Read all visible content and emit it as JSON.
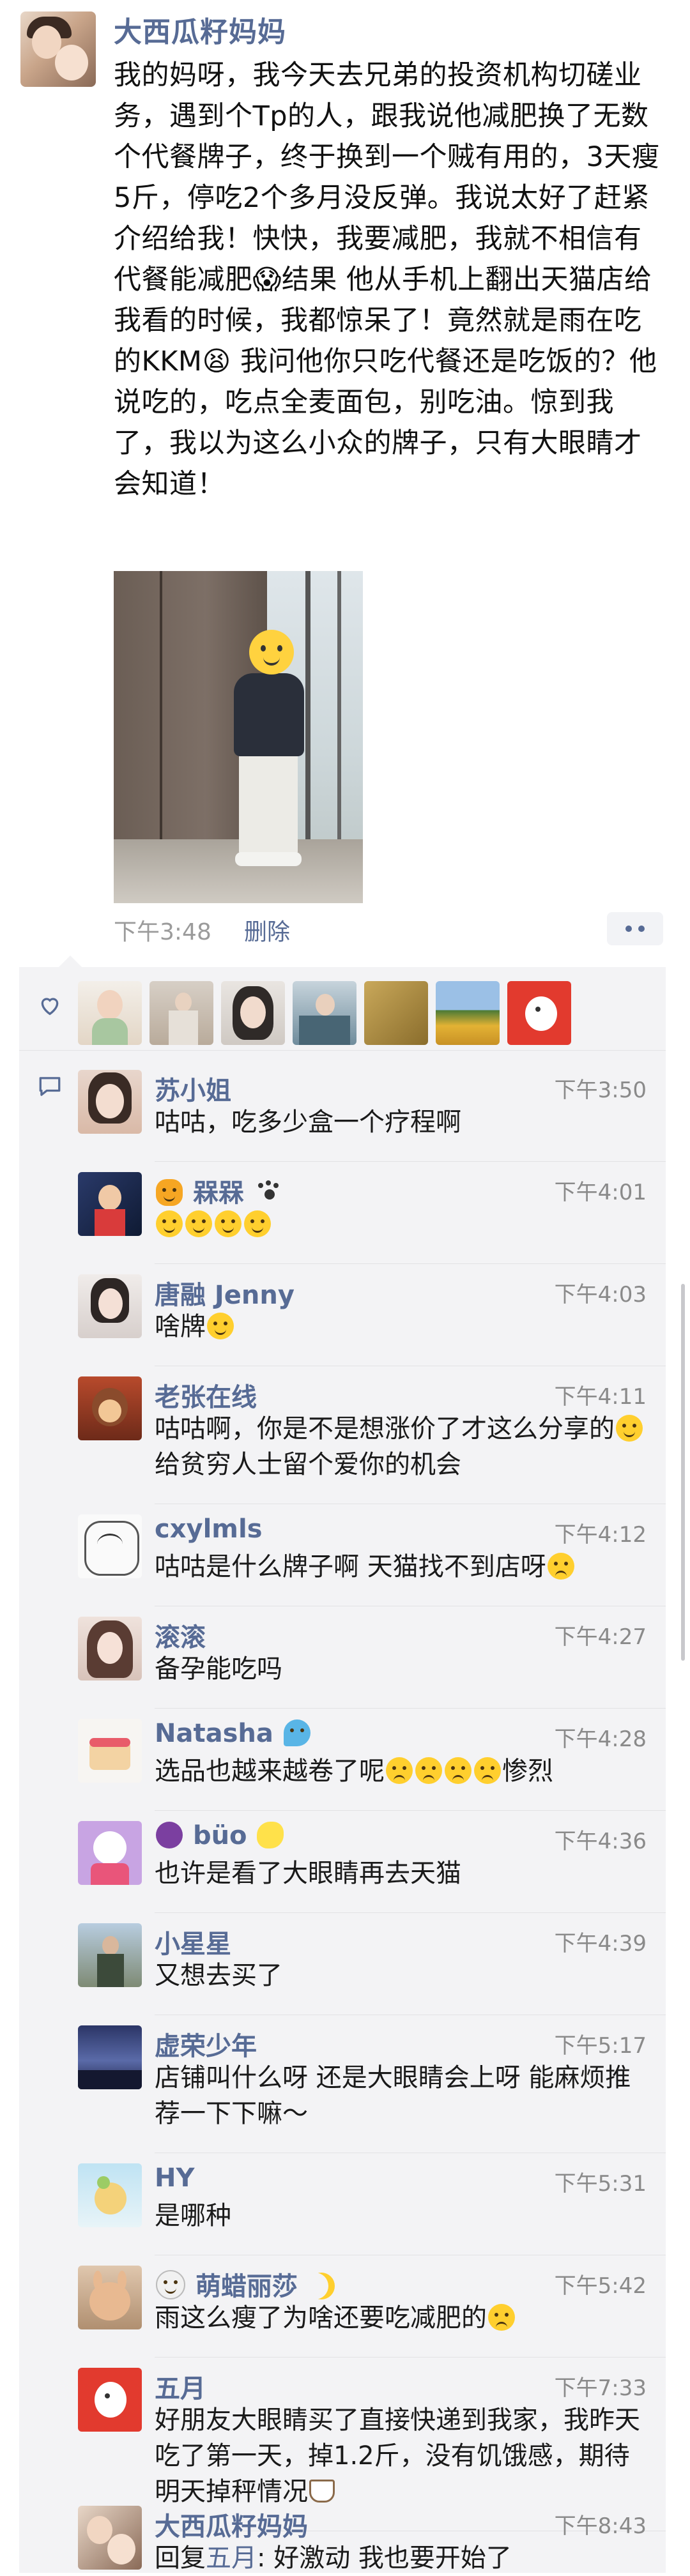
{
  "post": {
    "author": "大西瓜籽妈妈",
    "text": "我的妈呀，我今天去兄弟的投资机构切磋业务，遇到个Tp的人，跟我说他减肥换了无数个代餐牌子，终于换到一个贼有用的，3天瘦5斤，停吃2个多月没反弹。我说太好了赶紧介绍给我！快快，我要减肥，我就不相信有代餐能减肥😱结果 他从手机上翻出天猫店给我看的时候，我都惊呆了！竟然就是雨在吃的KKM😫 我问他你只吃代餐还是吃饭的？他说吃的，吃点全麦面包，别吃油。惊到我了，我以为这么小众的牌子，只有大眼睛才会知道！",
    "time": "下午3:48",
    "delete_label": "删除"
  },
  "likers": [
    "liker-1",
    "liker-2",
    "liker-3",
    "liker-4",
    "liker-5",
    "liker-6",
    "liker-7"
  ],
  "comments": [
    {
      "name": "苏小姐",
      "time": "下午3:50",
      "text": "咕咕，吃多少盒一个疗程啊"
    },
    {
      "name": "槑槑",
      "time": "下午4:01",
      "text": ""
    },
    {
      "name": "唐融 Jenny",
      "time": "下午4:03",
      "text": "啥牌"
    },
    {
      "name": "老张在线",
      "time": "下午4:11",
      "text_a": "咕咕啊，你是不是想涨价了才这么分享的",
      "text_b": "给贫穷人士留个爱你的机会"
    },
    {
      "name": "cxylmls",
      "time": "下午4:12",
      "text": "咕咕是什么牌子啊 天猫找不到店呀"
    },
    {
      "name": "滚滚",
      "time": "下午4:27",
      "text": "备孕能吃吗"
    },
    {
      "name": "Natasha",
      "time": "下午4:28",
      "text_a": "选品也越来越卷了呢",
      "text_b": "惨烈"
    },
    {
      "name": "büo",
      "time": "下午4:36",
      "text": "也许是看了大眼睛再去天猫"
    },
    {
      "name": "小星星",
      "time": "下午4:39",
      "text": "又想去买了"
    },
    {
      "name": "虚荣少年",
      "time": "下午5:17",
      "text": "店铺叫什么呀 还是大眼睛会上呀 能麻烦推荐一下下嘛～"
    },
    {
      "name": "HY",
      "time": "下午5:31",
      "text": "是哪种"
    },
    {
      "name": "萌蜡丽莎",
      "time": "下午5:42",
      "text": "雨这么瘦了为啥还要吃减肥的"
    },
    {
      "name": "五月",
      "time": "下午7:33",
      "text": "好朋友大眼睛买了直接快递到我家，我昨天吃了第一天，掉1.2斤，没有饥饿感，期待明天掉秤情况"
    },
    {
      "name": "大西瓜籽妈妈",
      "time": "下午8:43",
      "reply_prefix": "回复",
      "reply_to": "五月",
      "reply_text": ": 好激动 我也要开始了"
    }
  ]
}
